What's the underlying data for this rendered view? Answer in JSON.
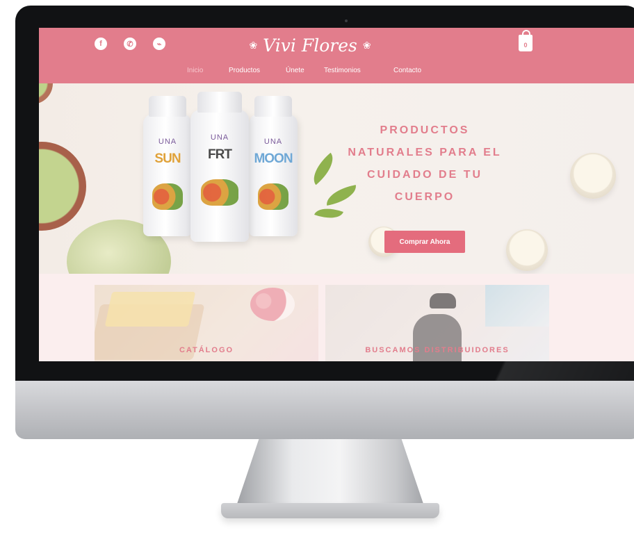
{
  "site": {
    "logo": "Vivi Flores",
    "cart_count": "0",
    "social": [
      {
        "icon": "facebook-icon",
        "glyph": "f"
      },
      {
        "icon": "whatsapp-icon",
        "glyph": "✆"
      },
      {
        "icon": "messenger-icon",
        "glyph": "⌁"
      }
    ],
    "nav": [
      {
        "label": "Inicio",
        "active": true
      },
      {
        "label": "Productos",
        "active": false
      },
      {
        "label": "Únete",
        "active": false
      },
      {
        "label": "Testimonios",
        "active": false
      },
      {
        "label": "Contacto",
        "active": false
      }
    ]
  },
  "hero": {
    "headline_lines": [
      "PRODUCTOS",
      "NATURALES PARA EL",
      "CUIDADO DE TU",
      "CUERPO"
    ],
    "cta_label": "Comprar Ahora",
    "bottles": [
      {
        "brand": "UNA",
        "name": "SUN",
        "name_color": "#e0a23a"
      },
      {
        "brand": "UNA",
        "name": "FRT",
        "name_color": "#4a4a4a"
      },
      {
        "brand": "UNA",
        "name": "MOON",
        "name_color": "#6fa8d6"
      }
    ]
  },
  "cards": {
    "catalog_label": "CATÁLOGO",
    "distributors_label": "BUSCAMOS DISTRIBUIDORES"
  },
  "colors": {
    "brand_pink": "#e27d8c",
    "cta_pink": "#e46c7d",
    "page_bg": "#fbeeee"
  }
}
